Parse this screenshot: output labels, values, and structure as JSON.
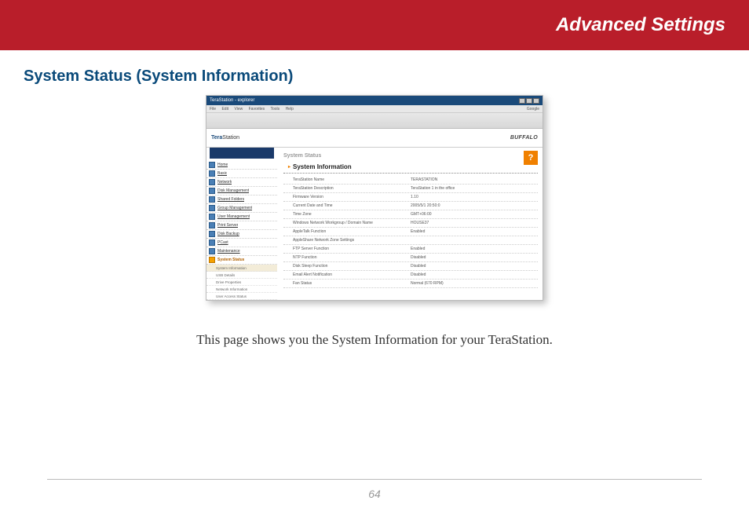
{
  "header": {
    "title": "Advanced Settings"
  },
  "section_title": "System Status (System Information)",
  "caption": "This page shows you the System Information for your TeraStation.",
  "page_number": "64",
  "screenshot": {
    "window_title": "TeraStation - explorer",
    "menu": {
      "items": [
        "File",
        "Edit",
        "View",
        "Favorites",
        "Tools",
        "Help"
      ],
      "go": "Google"
    },
    "brand": {
      "left_a": "Tera",
      "left_b": "Station",
      "right": "BUFFALO"
    },
    "help_icon": "?",
    "crumb": "System Status",
    "panel_title": "System Information",
    "nav": [
      "Home",
      "Basic",
      "Network",
      "Disk Management",
      "Shared Folders",
      "Group Management",
      "User Management",
      "Print Server",
      "Disk Backup",
      "PCast",
      "Maintenance"
    ],
    "nav_active": "System Status",
    "nav_sub": [
      "System Information",
      "USB Details",
      "Drive Properties",
      "Network Information",
      "User Access Status"
    ],
    "rows": [
      {
        "k": "TeraStation Name",
        "v": "TERASTATION"
      },
      {
        "k": "TeraStation Description",
        "v": "TeraStation 1 in the office"
      },
      {
        "k": "Firmware Version",
        "v": "1.10"
      },
      {
        "k": "Current Date and Time",
        "v": "2005/5/1 20:50:0"
      },
      {
        "k": "Time Zone",
        "v": "GMT+06:00"
      },
      {
        "k": "Windows Network Workgroup / Domain Name",
        "v": "HOUSE37"
      },
      {
        "k": "AppleTalk Function",
        "v": "Enabled"
      },
      {
        "k": "AppleShare Network Zone Settings",
        "v": ""
      },
      {
        "k": "FTP Server Function",
        "v": "Enabled"
      },
      {
        "k": "NTP Function",
        "v": "Disabled"
      },
      {
        "k": "Disk Sleep Function",
        "v": "Disabled"
      },
      {
        "k": "Email Alert Notification",
        "v": "Disabled"
      },
      {
        "k": "Fan Status",
        "v": "Normal (670 RPM)"
      }
    ]
  }
}
